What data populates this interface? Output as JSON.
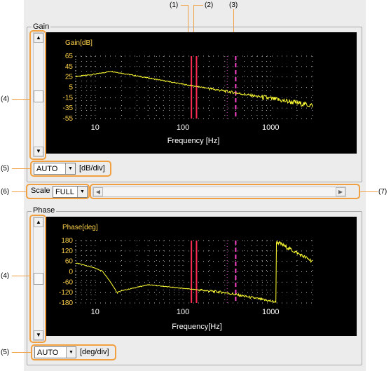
{
  "callouts": {
    "c1": "(1)",
    "c2": "(2)",
    "c3": "(3)",
    "c4": "(4)",
    "c5": "(5)",
    "c6": "(6)",
    "c7": "(7)"
  },
  "gain": {
    "group_title": "Gain",
    "plot_title": "Gain[dB]",
    "xlabel": "Frequency [Hz]",
    "y_ticks": [
      "65",
      "45",
      "25",
      "5",
      "-15",
      "-35",
      "-55"
    ],
    "x_ticks": [
      "10",
      "100",
      "1000"
    ],
    "scale_value": "AUTO",
    "scale_unit": "[dB/div]"
  },
  "scale": {
    "label": "Scale",
    "value": "FULL"
  },
  "phase": {
    "group_title": "Phase",
    "plot_title": "Phase[deg]",
    "xlabel": "Frequency[Hz]",
    "y_ticks": [
      "180",
      "120",
      "60",
      "0",
      "-60",
      "-120",
      "-180"
    ],
    "x_ticks": [
      "10",
      "100",
      "1000"
    ],
    "scale_value": "AUTO",
    "scale_unit": "[deg/div]"
  },
  "colors": {
    "trace": "#ffff33",
    "cursor1": "#ff2d55",
    "cursor2": "#ff2d55",
    "cursor3": "#ff44cc",
    "highlight": "#f0a040"
  }
}
